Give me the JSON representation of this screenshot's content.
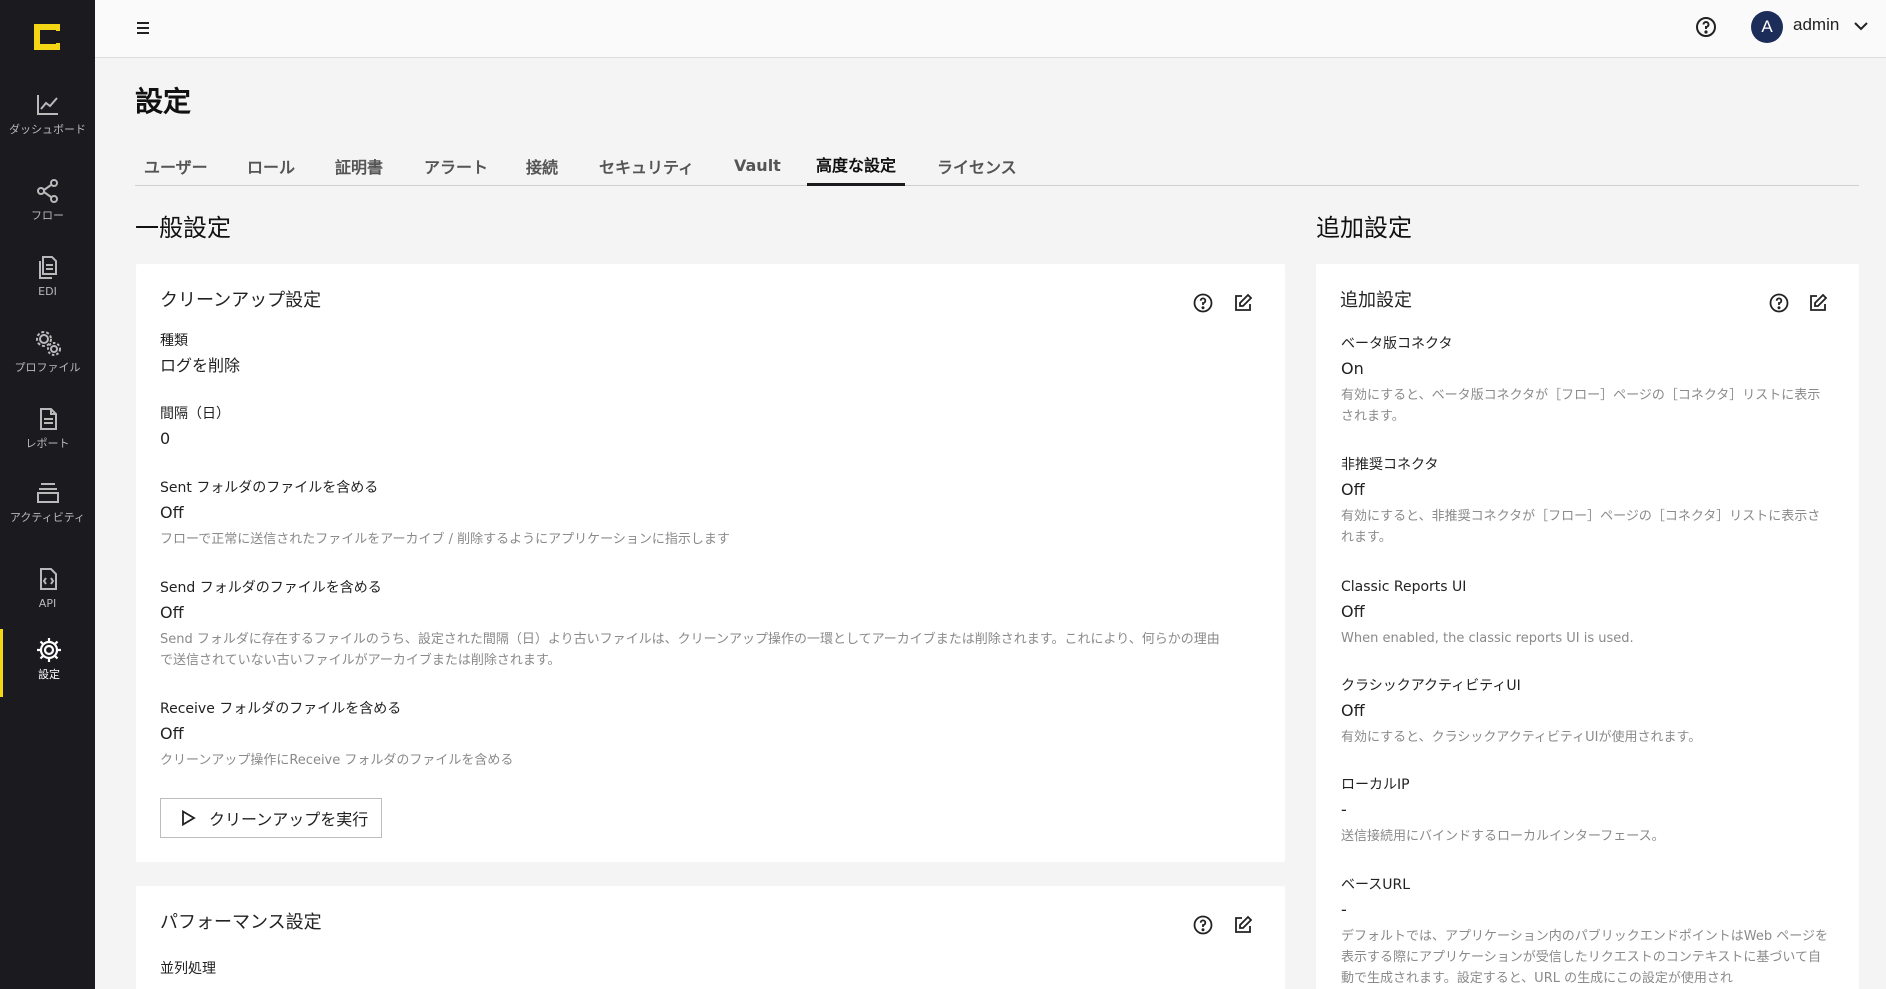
{
  "sidebar": {
    "logo": "C-logo",
    "items": [
      {
        "label": "ダッシュボード",
        "icon": "chart-line-icon"
      },
      {
        "label": "フロー",
        "icon": "share-nodes-icon"
      },
      {
        "label": "EDI",
        "icon": "documents-icon"
      },
      {
        "label": "プロファイル",
        "icon": "gears-icon"
      },
      {
        "label": "レポート",
        "icon": "report-icon"
      },
      {
        "label": "アクティビティ",
        "icon": "layers-icon"
      },
      {
        "label": "API",
        "icon": "api-file-icon"
      },
      {
        "label": "設定",
        "icon": "gear-icon",
        "active": true
      }
    ]
  },
  "topbar": {
    "user_initial": "A",
    "user_name": "admin"
  },
  "page": {
    "title": "設定",
    "tabs": [
      "ユーザー",
      "ロール",
      "証明書",
      "アラート",
      "接続",
      "セキュリティ",
      "Vault",
      "高度な設定",
      "ライセンス"
    ],
    "active_tab": "高度な設定"
  },
  "general": {
    "section_title": "一般設定",
    "cleanup": {
      "title": "クリーンアップ設定",
      "fields": [
        {
          "label": "種類",
          "value": "ログを削除",
          "desc": ""
        },
        {
          "label": "間隔（日）",
          "value": "0",
          "desc": ""
        },
        {
          "label": "Sent フォルダのファイルを含める",
          "value": "Off",
          "desc": "フローで正常に送信されたファイルをアーカイブ / 削除するようにアプリケーションに指示します"
        },
        {
          "label": "Send フォルダのファイルを含める",
          "value": "Off",
          "desc": "Send フォルダに存在するファイルのうち、設定された間隔（日）より古いファイルは、クリーンアップ操作の一環としてアーカイブまたは削除されます。これにより、何らかの理由で送信されていない古いファイルがアーカイブまたは削除されます。"
        },
        {
          "label": "Receive フォルダのファイルを含める",
          "value": "Off",
          "desc": "クリーンアップ操作にReceive フォルダのファイルを含める"
        }
      ],
      "run_button": "クリーンアップを実行"
    },
    "performance": {
      "title": "パフォーマンス設定",
      "fields": [
        {
          "label": "並列処理"
        }
      ]
    }
  },
  "additional": {
    "section_title": "追加設定",
    "card_title": "追加設定",
    "fields": [
      {
        "label": "ベータ版コネクタ",
        "value": "On",
        "desc": "有効にすると、ベータ版コネクタが［フロー］ページの［コネクタ］リストに表示されます。"
      },
      {
        "label": "非推奨コネクタ",
        "value": "Off",
        "desc": "有効にすると、非推奨コネクタが［フロー］ページの［コネクタ］リストに表示されます。"
      },
      {
        "label": "Classic Reports UI",
        "value": "Off",
        "desc": "When enabled, the classic reports UI is used."
      },
      {
        "label": "クラシックアクティビティUI",
        "value": "Off",
        "desc": "有効にすると、クラシックアクティビティUIが使用されます。"
      },
      {
        "label": "ローカルIP",
        "value": "-",
        "desc": "送信接続用にバインドするローカルインターフェース。"
      },
      {
        "label": "ベースURL",
        "value": "-",
        "desc": "デフォルトでは、アプリケーション内のパブリックエンドポイントはWeb ページを表示する際にアプリケーションが受信したリクエストのコンテキストに基づいて自動で生成されます。設定すると、URL の生成にこの設定が使用され"
      }
    ]
  },
  "colors": {
    "sidebar_bg": "#1b1b1f",
    "accent": "#f5d614",
    "avatar_bg": "#1d2d5a"
  }
}
